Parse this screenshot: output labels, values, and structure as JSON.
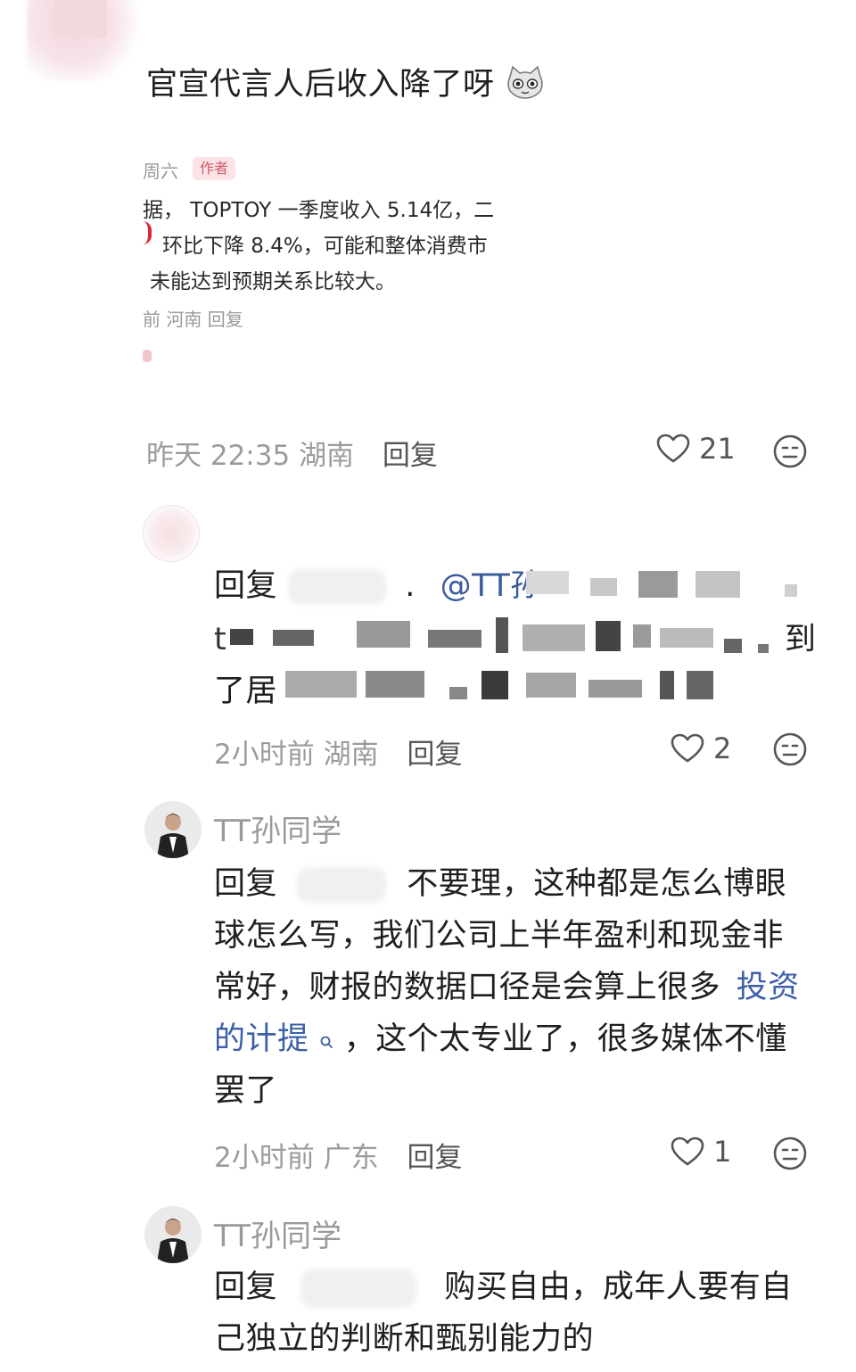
{
  "comment1": {
    "text": "官宣代言人后收入降了呀",
    "emoji": "cat-face-emoji",
    "embed": {
      "meta": "周六",
      "badge": "作者",
      "line1": "据， TOPTOY 一季度收入 5.14亿，二",
      "line2": "环比下降 8.4%，可能和整体消费市",
      "line3": "未能达到预期关系比较大。",
      "line4": "前 河南   回复"
    },
    "time": "昨天 22:35",
    "location": "湖南",
    "reply": "回复",
    "likes": "21"
  },
  "comment2": {
    "reply_prefix": "回复",
    "mention": "@TT孙",
    "line2_end": "到",
    "line3_start": "了居",
    "time": "2小时前",
    "location": "湖南",
    "reply": "回复",
    "likes": "2"
  },
  "comment3": {
    "username": "TT孙同学",
    "reply_prefix": "回复",
    "line1": "不要理，这种都是怎么博眼",
    "line2": "球怎么写，我们公司上半年盈利和现金非",
    "line3_a": "常好，财报的数据口径是会算上很多",
    "line3_link": "投资",
    "line4_link": "的计提",
    "line4_rest": "，这个太专业了，很多媒体不懂",
    "line5": "罢了",
    "time": "2小时前",
    "location": "广东",
    "reply": "回复",
    "likes": "1"
  },
  "comment4": {
    "username": "TT孙同学",
    "reply_prefix": "回复",
    "line1": "购买自由，成年人要有自",
    "line2": "己独立的判断和甄别能力的"
  },
  "colors": {
    "link": "#3d5fa8",
    "meta": "#9b9b9b",
    "badge": "#d45a6a"
  }
}
